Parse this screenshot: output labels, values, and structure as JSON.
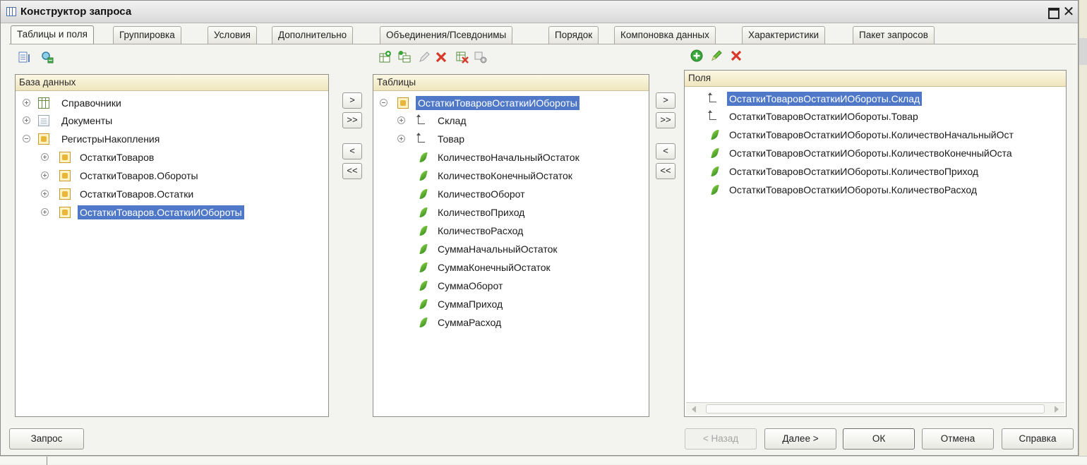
{
  "window": {
    "title": "Конструктор запроса"
  },
  "tabs": [
    {
      "label": "Таблицы и поля",
      "active": true
    },
    {
      "label": "Группировка"
    },
    {
      "label": "Условия"
    },
    {
      "label": "Дополнительно"
    },
    {
      "label": "Объединения/Псевдонимы"
    },
    {
      "label": "Порядок"
    },
    {
      "label": "Компоновка данных"
    },
    {
      "label": "Характеристики"
    },
    {
      "label": "Пакет запросов"
    }
  ],
  "database": {
    "header": "База данных",
    "items": [
      {
        "label": "Справочники",
        "icon": "catalog-icon",
        "expander": "plus"
      },
      {
        "label": "Документы",
        "icon": "document-icon",
        "expander": "plus"
      },
      {
        "label": "РегистрыНакопления",
        "icon": "register-icon",
        "expander": "minus"
      },
      {
        "label": "ОстаткиТоваров",
        "icon": "register-icon",
        "expander": "plus"
      },
      {
        "label": "ОстаткиТоваров.Обороты",
        "icon": "register-icon",
        "expander": "plus"
      },
      {
        "label": "ОстаткиТоваров.Остатки",
        "icon": "register-icon",
        "expander": "plus"
      },
      {
        "label": "ОстаткиТоваров.ОстаткиИОбороты",
        "icon": "register-icon",
        "expander": "plus",
        "selected": true
      }
    ]
  },
  "transfer_buttons": {
    "add": ">",
    "add_all": ">>",
    "remove": "<",
    "remove_all": "<<"
  },
  "tables": {
    "header": "Таблицы",
    "items": [
      {
        "label": "ОстаткиТоваровОстаткиИОбороты",
        "icon": "register-icon",
        "expander": "minus",
        "selected": true
      },
      {
        "label": "Склад",
        "icon": "dimension-icon",
        "expander": "plus"
      },
      {
        "label": "Товар",
        "icon": "dimension-icon",
        "expander": "plus"
      },
      {
        "label": "КоличествоНачальныйОстаток",
        "icon": "resource-icon"
      },
      {
        "label": "КоличествоКонечныйОстаток",
        "icon": "resource-icon"
      },
      {
        "label": "КоличествоОборот",
        "icon": "resource-icon"
      },
      {
        "label": "КоличествоПриход",
        "icon": "resource-icon"
      },
      {
        "label": "КоличествоРасход",
        "icon": "resource-icon"
      },
      {
        "label": "СуммаНачальныйОстаток",
        "icon": "resource-icon"
      },
      {
        "label": "СуммаКонечныйОстаток",
        "icon": "resource-icon"
      },
      {
        "label": "СуммаОборот",
        "icon": "resource-icon"
      },
      {
        "label": "СуммаПриход",
        "icon": "resource-icon"
      },
      {
        "label": "СуммаРасход",
        "icon": "resource-icon"
      }
    ]
  },
  "fields": {
    "header": "Поля",
    "items": [
      {
        "label": "ОстаткиТоваровОстаткиИОбороты.Склад",
        "icon": "dimension-icon",
        "selected": true
      },
      {
        "label": "ОстаткиТоваровОстаткиИОбороты.Товар",
        "icon": "dimension-icon"
      },
      {
        "label": "ОстаткиТоваровОстаткиИОбороты.КоличествоНачальныйОст",
        "icon": "resource-icon"
      },
      {
        "label": "ОстаткиТоваровОстаткиИОбороты.КоличествоКонечныйОста",
        "icon": "resource-icon"
      },
      {
        "label": "ОстаткиТоваровОстаткиИОбороты.КоличествоПриход",
        "icon": "resource-icon"
      },
      {
        "label": "ОстаткиТоваровОстаткиИОбороты.КоличествоРасход",
        "icon": "resource-icon"
      }
    ]
  },
  "footer": {
    "query": "Запрос",
    "back": "< Назад",
    "next": "Далее >",
    "ok": "ОК",
    "cancel": "Отмена",
    "help": "Справка"
  },
  "colors": {
    "selection": "#4f79c8",
    "header_bg": "#efe6bd",
    "add_green": "#3aa63a",
    "delete_red": "#d83a2a"
  }
}
